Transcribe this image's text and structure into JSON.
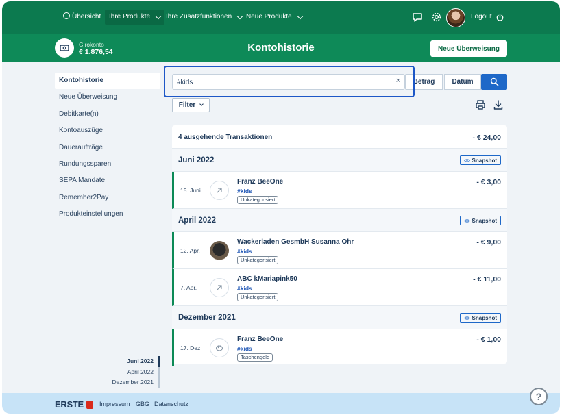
{
  "nav": {
    "overview": "Übersicht",
    "products": "Ihre Produkte",
    "extras": "Ihre Zusatzfunktionen",
    "new_products": "Neue Produkte",
    "logout": "Logout"
  },
  "header": {
    "account_name": "Girokonto",
    "account_balance": "€ 1.876,54",
    "title": "Kontohistorie",
    "new_transfer": "Neue Überweisung"
  },
  "sidebar": {
    "items": [
      {
        "label": "Kontohistorie"
      },
      {
        "label": "Neue Überweisung"
      },
      {
        "label": "Debitkarte(n)"
      },
      {
        "label": "Kontoauszüge"
      },
      {
        "label": "Daueraufträge"
      },
      {
        "label": "Rundungssparen"
      },
      {
        "label": "SEPA Mandate"
      },
      {
        "label": "Remember2Pay"
      },
      {
        "label": "Produkteinstellungen"
      }
    ]
  },
  "timeline": {
    "items": [
      {
        "label": "Juni 2022"
      },
      {
        "label": "April 2022"
      },
      {
        "label": "Dezember 2021"
      }
    ]
  },
  "search": {
    "value": "#kids",
    "clear": "×",
    "sort_amount": "Betrag",
    "sort_date": "Datum",
    "filter": "Filter"
  },
  "summary": {
    "label": "4 ausgehende Transaktionen",
    "amount": "- € 24,00"
  },
  "months": [
    {
      "label": "Juni 2022",
      "snapshot": "Snapshot"
    },
    {
      "label": "April 2022",
      "snapshot": "Snapshot"
    },
    {
      "label": "Dezember 2021",
      "snapshot": "Snapshot"
    }
  ],
  "transactions": [
    {
      "date": "15. Juni",
      "name": "Franz BeeOne",
      "tag": "#kids",
      "category": "Unkategorisiert",
      "amount": "- € 3,00",
      "icon": "arrow-up-right-icon"
    },
    {
      "date": "12. Apr.",
      "name": "Wackerladen GesmbH Susanna Ohr",
      "tag": "#kids",
      "category": "Unkategorisiert",
      "amount": "- € 9,00",
      "icon": "merchant-photo"
    },
    {
      "date": "7. Apr.",
      "name": "ABC kMariapink50",
      "tag": "#kids",
      "category": "Unkategorisiert",
      "amount": "- € 11,00",
      "icon": "arrow-up-right-icon"
    },
    {
      "date": "17. Dez.",
      "name": "Franz BeeOne",
      "tag": "#kids",
      "category": "Taschengeld",
      "amount": "- € 1,00",
      "icon": "piggy-bank-icon"
    }
  ],
  "footer": {
    "logo": "ERSTE",
    "impressum": "Impressum",
    "gbg": "GBG",
    "privacy": "Datenschutz"
  },
  "help": "?",
  "colors": {
    "nav_green": "#0c7a4f",
    "header_green": "#0e8a58",
    "accent_blue": "#1e68c8",
    "footer_blue": "#c7e3f7"
  }
}
